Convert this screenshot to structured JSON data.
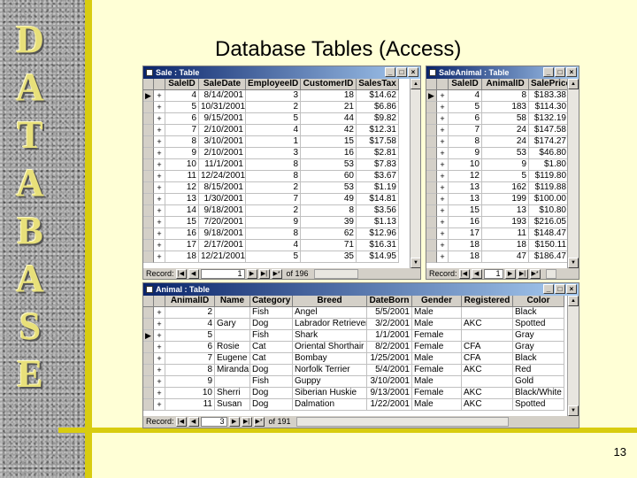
{
  "slide": {
    "title": "Database Tables (Access)",
    "side_letters": [
      "D",
      "A",
      "T",
      "A",
      "B",
      "A",
      "S",
      "E"
    ],
    "slide_number": "13"
  },
  "colors": {
    "background": "#ffffd6",
    "accent_bar": "#d8cc10",
    "side_letter": "#e8e07a",
    "titlebar": "#0a246a"
  },
  "sale": {
    "title": "Sale : Table",
    "columns": [
      "SaleID",
      "SaleDate",
      "EmployeeID",
      "CustomerID",
      "SalesTax"
    ],
    "rows": [
      [
        "4",
        "8/14/2001",
        "3",
        "18",
        "$14.62"
      ],
      [
        "5",
        "10/31/2001",
        "2",
        "21",
        "$6.86"
      ],
      [
        "6",
        "9/15/2001",
        "5",
        "44",
        "$9.82"
      ],
      [
        "7",
        "2/10/2001",
        "4",
        "42",
        "$12.31"
      ],
      [
        "8",
        "3/10/2001",
        "1",
        "15",
        "$17.58"
      ],
      [
        "9",
        "2/10/2001",
        "3",
        "16",
        "$2.81"
      ],
      [
        "10",
        "11/1/2001",
        "8",
        "53",
        "$7.83"
      ],
      [
        "11",
        "12/24/2001",
        "8",
        "60",
        "$3.67"
      ],
      [
        "12",
        "8/15/2001",
        "2",
        "53",
        "$1.19"
      ],
      [
        "13",
        "1/30/2001",
        "7",
        "49",
        "$14.81"
      ],
      [
        "14",
        "9/18/2001",
        "2",
        "8",
        "$3.56"
      ],
      [
        "15",
        "7/20/2001",
        "9",
        "39",
        "$1.13"
      ],
      [
        "16",
        "9/18/2001",
        "8",
        "62",
        "$12.96"
      ],
      [
        "17",
        "2/17/2001",
        "4",
        "71",
        "$16.31"
      ],
      [
        "18",
        "12/21/2001",
        "5",
        "35",
        "$14.95"
      ]
    ],
    "nav": {
      "label": "Record:",
      "current": "1",
      "total": "of 196"
    }
  },
  "saleanimal": {
    "title": "SaleAnimal : Table",
    "columns": [
      "SaleID",
      "AnimalID",
      "SalePrice"
    ],
    "rows": [
      [
        "4",
        "8",
        "$183.38"
      ],
      [
        "5",
        "183",
        "$114.30"
      ],
      [
        "6",
        "58",
        "$132.19"
      ],
      [
        "7",
        "24",
        "$147.58"
      ],
      [
        "8",
        "24",
        "$174.27"
      ],
      [
        "9",
        "53",
        "$46.80"
      ],
      [
        "10",
        "9",
        "$1.80"
      ],
      [
        "12",
        "5",
        "$119.80"
      ],
      [
        "13",
        "162",
        "$119.88"
      ],
      [
        "13",
        "199",
        "$100.00"
      ],
      [
        "15",
        "13",
        "$10.80"
      ],
      [
        "16",
        "193",
        "$216.05"
      ],
      [
        "17",
        "11",
        "$148.47"
      ],
      [
        "18",
        "18",
        "$150.11"
      ],
      [
        "18",
        "47",
        "$186.47"
      ]
    ],
    "nav": {
      "label": "Record:",
      "current": "1",
      "total": ""
    }
  },
  "animal": {
    "title": "Animal : Table",
    "columns": [
      "AnimalID",
      "Name",
      "Category",
      "Breed",
      "DateBorn",
      "Gender",
      "Registered",
      "Color"
    ],
    "rows": [
      [
        "2",
        "",
        "Fish",
        "Angel",
        "5/5/2001",
        "Male",
        "",
        "Black"
      ],
      [
        "4",
        "Gary",
        "Dog",
        "Labrador Retriever",
        "3/2/2001",
        "Male",
        "AKC",
        "Spotted"
      ],
      [
        "5",
        "",
        "Fish",
        "Shark",
        "1/1/2001",
        "Female",
        "",
        "Gray"
      ],
      [
        "6",
        "Rosie",
        "Cat",
        "Oriental Shorthair",
        "8/2/2001",
        "Female",
        "CFA",
        "Gray"
      ],
      [
        "7",
        "Eugene",
        "Cat",
        "Bombay",
        "1/25/2001",
        "Male",
        "CFA",
        "Black"
      ],
      [
        "8",
        "Miranda",
        "Dog",
        "Norfolk Terrier",
        "5/4/2001",
        "Female",
        "AKC",
        "Red"
      ],
      [
        "9",
        "",
        "Fish",
        "Guppy",
        "3/10/2001",
        "Male",
        "",
        "Gold"
      ],
      [
        "10",
        "Sherri",
        "Dog",
        "Siberian Huskie",
        "9/13/2001",
        "Female",
        "AKC",
        "Black/White"
      ],
      [
        "11",
        "Susan",
        "Dog",
        "Dalmation",
        "1/22/2001",
        "Male",
        "AKC",
        "Spotted"
      ]
    ],
    "nav": {
      "label": "Record:",
      "current": "3",
      "total": "of 191"
    }
  }
}
